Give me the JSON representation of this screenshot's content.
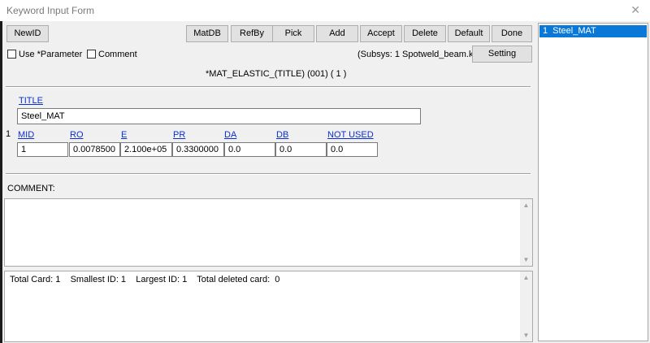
{
  "window": {
    "title": "Keyword Input Form"
  },
  "toolbar": {
    "newid": "NewID",
    "matdb": "MatDB",
    "refby": "RefBy",
    "pick": "Pick",
    "add": "Add",
    "accept": "Accept",
    "delete": "Delete",
    "default": "Default",
    "done": "Done"
  },
  "options": {
    "use_parameter": "Use *Parameter",
    "comment": "Comment",
    "subsys": "(Subsys: 1 Spotweld_beam.k)",
    "setting": "Setting"
  },
  "keyword": {
    "heading": "*MAT_ELASTIC_(TITLE) (001)    ( 1 )"
  },
  "title_card": {
    "label": "TITLE",
    "value": "Steel_MAT"
  },
  "card1": {
    "row_number": "1",
    "fields": [
      {
        "label": "MID",
        "value": "1"
      },
      {
        "label": "RO",
        "value": "0.0078500"
      },
      {
        "label": "E",
        "value": "2.100e+05"
      },
      {
        "label": "PR",
        "value": "0.3300000"
      },
      {
        "label": "DA",
        "value": "0.0"
      },
      {
        "label": "DB",
        "value": "0.0"
      },
      {
        "label": "NOT USED",
        "value": "0.0"
      }
    ]
  },
  "comment": {
    "label": "COMMENT:"
  },
  "info": {
    "text": "Total Card: 1    Smallest ID: 1    Largest ID: 1    Total deleted card:  0"
  },
  "list": {
    "items": [
      {
        "index": "1",
        "name": "Steel_MAT"
      }
    ]
  }
}
